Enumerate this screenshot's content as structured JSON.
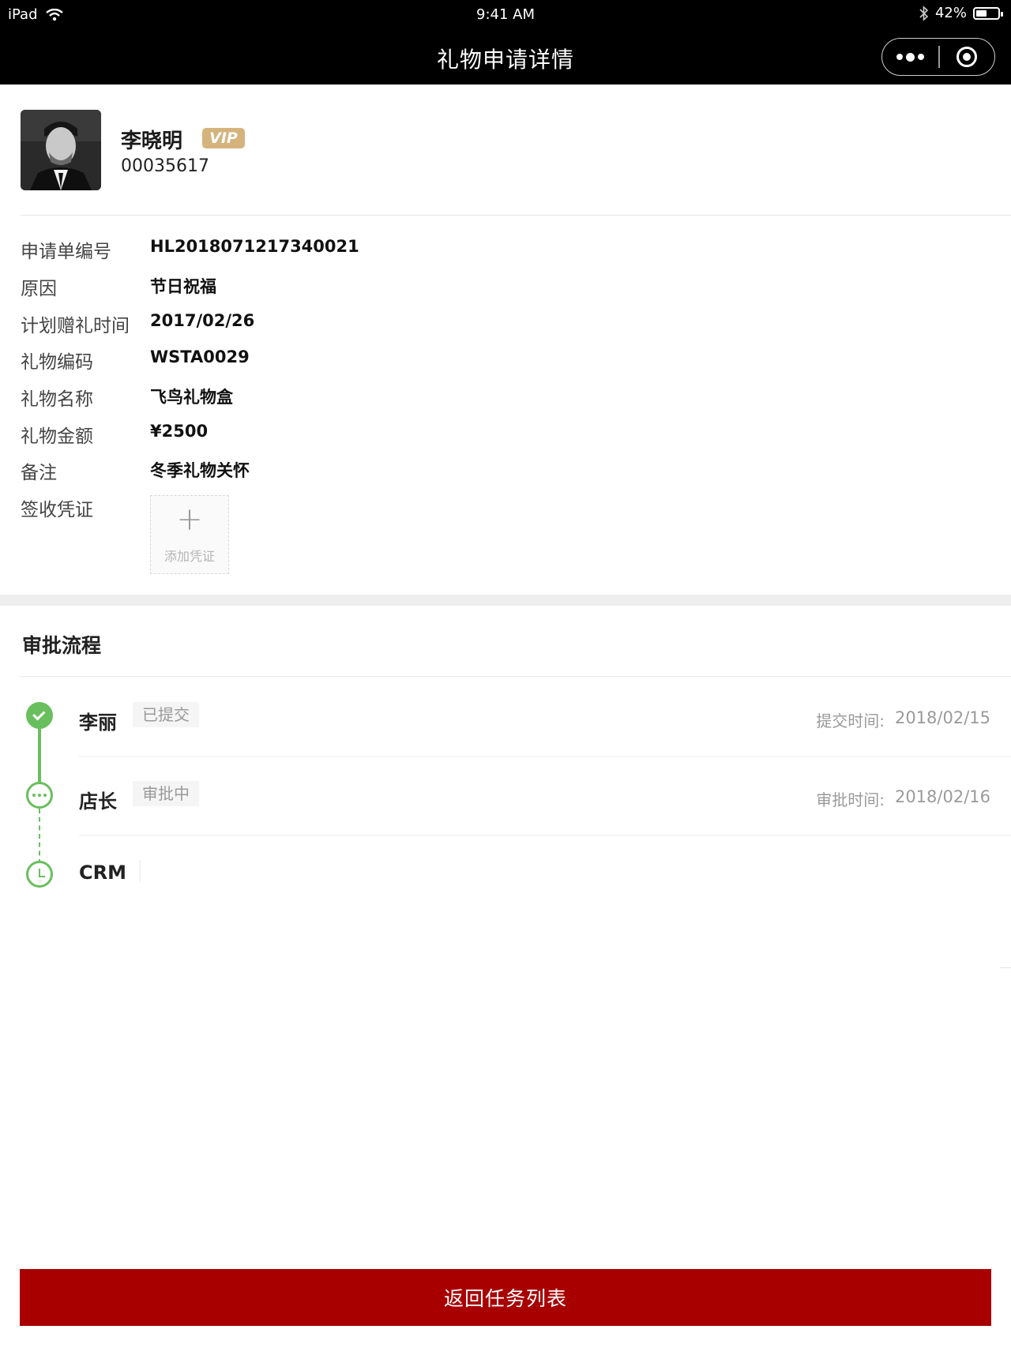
{
  "status_bar": {
    "device": "iPad",
    "time": "9:41 AM",
    "battery": "42%",
    "battery_level": 0.42
  },
  "nav": {
    "title": "礼物申请详情"
  },
  "profile": {
    "name": "李晓明",
    "badge": "VIP",
    "member_id": "00035617"
  },
  "details": [
    {
      "label": "申请单编号",
      "value": "HL2018071217340021"
    },
    {
      "label": "原因",
      "value": "节日祝福"
    },
    {
      "label": "计划赠礼时间",
      "value": "2017/02/26"
    },
    {
      "label": "礼物编码",
      "value": "WSTA0029"
    },
    {
      "label": "礼物名称",
      "value": "飞鸟礼物盒"
    },
    {
      "label": "礼物金额",
      "value": "¥2500"
    },
    {
      "label": "备注",
      "value": "冬季礼物关怀"
    },
    {
      "label": "签收凭证",
      "value": ""
    }
  ],
  "upload": {
    "label": "添加凭证"
  },
  "approval": {
    "title": "审批流程",
    "steps": [
      {
        "who": "李丽",
        "status": "已提交",
        "time_label": "提交时间:",
        "time": "2018/02/15",
        "state": "done"
      },
      {
        "who": "店长",
        "status": "审批中",
        "time_label": "审批时间:",
        "time": "2018/02/16",
        "state": "progress"
      },
      {
        "who": "CRM",
        "status": "",
        "time_label": "",
        "time": "",
        "state": "waiting"
      }
    ]
  },
  "footer": {
    "return_button": "返回任务列表"
  },
  "colors": {
    "accent_red": "#a80000",
    "timeline_green": "#69bf5d",
    "vip_gold": "#d4b37c"
  }
}
